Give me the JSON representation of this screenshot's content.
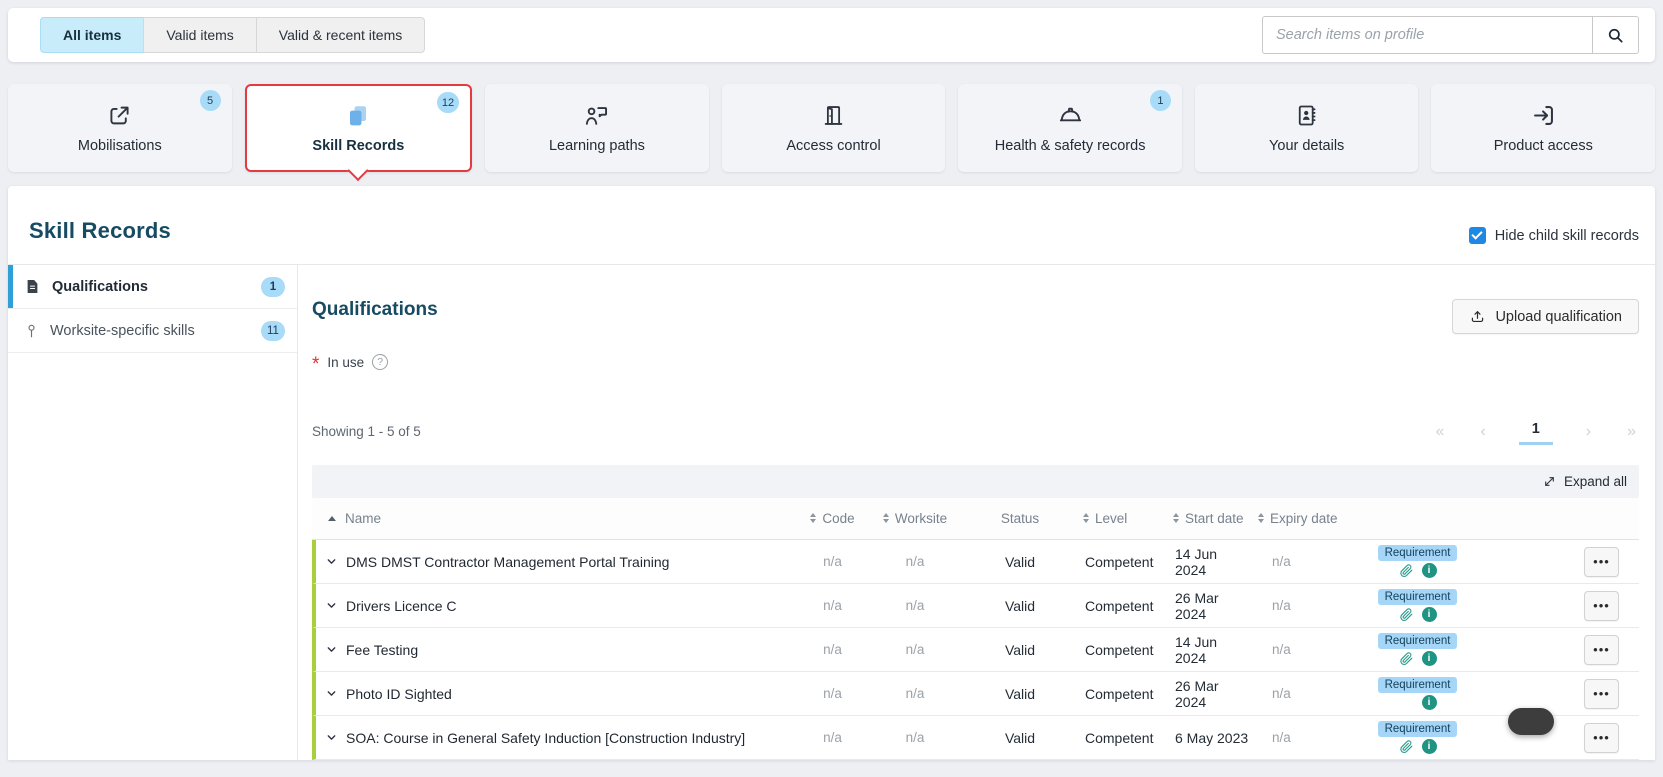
{
  "colors": {
    "accent_blue": "#2f9fd8",
    "selected_red": "#e23b40",
    "badge_blue": "#a7dbf8",
    "row_green": "#a9cf3d",
    "teal": "#1f9482",
    "tag_bg": "#a5d6f7",
    "navy": "#174b63",
    "active_tab_bg": "#c9ecfa"
  },
  "toolbar": {
    "filter_tabs": [
      {
        "label": "All items",
        "active": true
      },
      {
        "label": "Valid items",
        "active": false
      },
      {
        "label": "Valid & recent items",
        "active": false
      }
    ],
    "search": {
      "placeholder": "Search items on profile"
    }
  },
  "nav_cards": [
    {
      "label": "Mobilisations",
      "badge": "5",
      "icon": "export-icon",
      "selected": false
    },
    {
      "label": "Skill Records",
      "badge": "12",
      "icon": "documents-icon",
      "selected": true
    },
    {
      "label": "Learning paths",
      "icon": "learning-icon",
      "selected": false
    },
    {
      "label": "Access control",
      "icon": "door-icon",
      "selected": false
    },
    {
      "label": "Health & safety records",
      "badge": "1",
      "icon": "hardhat-icon",
      "selected": false
    },
    {
      "label": "Your details",
      "icon": "contact-card-icon",
      "selected": false
    },
    {
      "label": "Product access",
      "icon": "login-arrow-icon",
      "selected": false
    }
  ],
  "section": {
    "title": "Skill Records",
    "hide_child_label": "Hide child skill records",
    "hide_child_checked": true
  },
  "sidebar": {
    "items": [
      {
        "label": "Qualifications",
        "badge": "1",
        "active": true
      },
      {
        "label": "Worksite-specific skills",
        "badge": "11",
        "active": false
      }
    ]
  },
  "main": {
    "title": "Qualifications",
    "upload_button_label": "Upload qualification",
    "in_use_marker": "*",
    "in_use_label": "In use",
    "showing_text": "Showing 1 - 5 of 5",
    "pagination": {
      "first": "«",
      "prev": "‹",
      "page": "1",
      "next": "›",
      "last": "»"
    },
    "expand_all_label": "Expand all",
    "table": {
      "columns": [
        {
          "label": "Name",
          "sort": "asc"
        },
        {
          "label": "Code",
          "sort": "both"
        },
        {
          "label": "Worksite",
          "sort": "both"
        },
        {
          "label": "Status",
          "sort": "none"
        },
        {
          "label": "Level",
          "sort": "both"
        },
        {
          "label": "Start date",
          "sort": "both"
        },
        {
          "label": "Expiry date",
          "sort": "both"
        }
      ],
      "rows": [
        {
          "name": "DMS DMST Contractor Management Portal Training",
          "code": "n/a",
          "worksite": "n/a",
          "status": "Valid",
          "level": "Competent",
          "start_date": "14 Jun 2024",
          "expiry_date": "n/a",
          "tag": "Requirement",
          "has_attachment": true,
          "has_info": true
        },
        {
          "name": "Drivers Licence C",
          "code": "n/a",
          "worksite": "n/a",
          "status": "Valid",
          "level": "Competent",
          "start_date": "26 Mar 2024",
          "expiry_date": "n/a",
          "tag": "Requirement",
          "has_attachment": true,
          "has_info": true
        },
        {
          "name": "Fee Testing",
          "code": "n/a",
          "worksite": "n/a",
          "status": "Valid",
          "level": "Competent",
          "start_date": "14 Jun 2024",
          "expiry_date": "n/a",
          "tag": "Requirement",
          "has_attachment": true,
          "has_info": true
        },
        {
          "name": "Photo ID Sighted",
          "code": "n/a",
          "worksite": "n/a",
          "status": "Valid",
          "level": "Competent",
          "start_date": "26 Mar 2024",
          "expiry_date": "n/a",
          "tag": "Requirement",
          "has_attachment": false,
          "has_info": true
        },
        {
          "name": "SOA: Course in General Safety Induction [Construction Industry]",
          "code": "n/a",
          "worksite": "n/a",
          "status": "Valid",
          "level": "Competent",
          "start_date": "6 May 2023",
          "expiry_date": "n/a",
          "tag": "Requirement",
          "has_attachment": true,
          "has_info": true
        }
      ]
    }
  }
}
